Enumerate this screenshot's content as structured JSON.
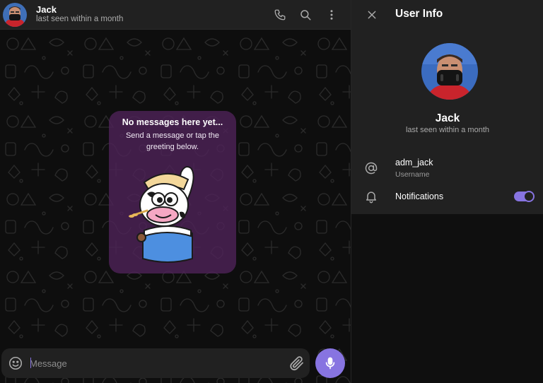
{
  "chat": {
    "name": "Jack",
    "status": "last seen within a month"
  },
  "empty_state": {
    "title": "No messages here yet...",
    "subtitle": "Send a message or tap the greeting below."
  },
  "composer": {
    "placeholder": "Message"
  },
  "user_info": {
    "title": "User Info",
    "name": "Jack",
    "status": "last seen within a month",
    "username": "adm_jack",
    "username_label": "Username",
    "notifications_label": "Notifications",
    "notifications_enabled": true
  },
  "icons": {
    "call": "phone-icon",
    "search": "search-icon",
    "menu": "more-vertical-icon",
    "close": "close-icon",
    "emoji": "smile-icon",
    "attach": "paperclip-icon",
    "mic": "microphone-icon",
    "username": "at-sign-icon",
    "notifications": "bell-icon"
  },
  "colors": {
    "accent": "#8774e1",
    "header_bg": "#212121",
    "chat_bg": "#0e0e0e",
    "card_bg": "#50225a"
  }
}
